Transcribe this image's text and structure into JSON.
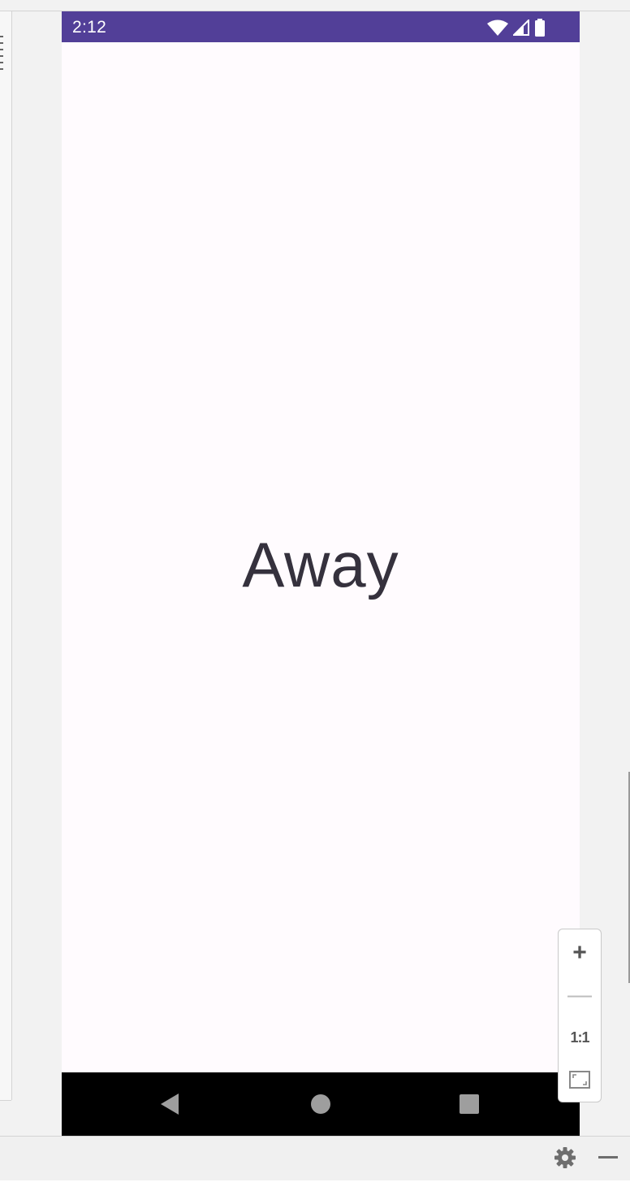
{
  "status_bar": {
    "time": "2:12",
    "icons": [
      "wifi-icon",
      "signal-icon",
      "battery-icon"
    ],
    "background": "#523f98"
  },
  "screen": {
    "text": "Away",
    "background": "#fffbfe",
    "text_color": "#35313d"
  },
  "nav_bar": {
    "buttons": [
      "back-icon",
      "home-icon",
      "recents-icon"
    ]
  },
  "zoom_controls": {
    "zoom_in": "+",
    "zoom_out": "—",
    "actual_size": "1:1",
    "fit_icon": "fit-screen-icon"
  },
  "tool_window": {
    "icons": [
      "gear-icon",
      "minimize-icon"
    ]
  }
}
